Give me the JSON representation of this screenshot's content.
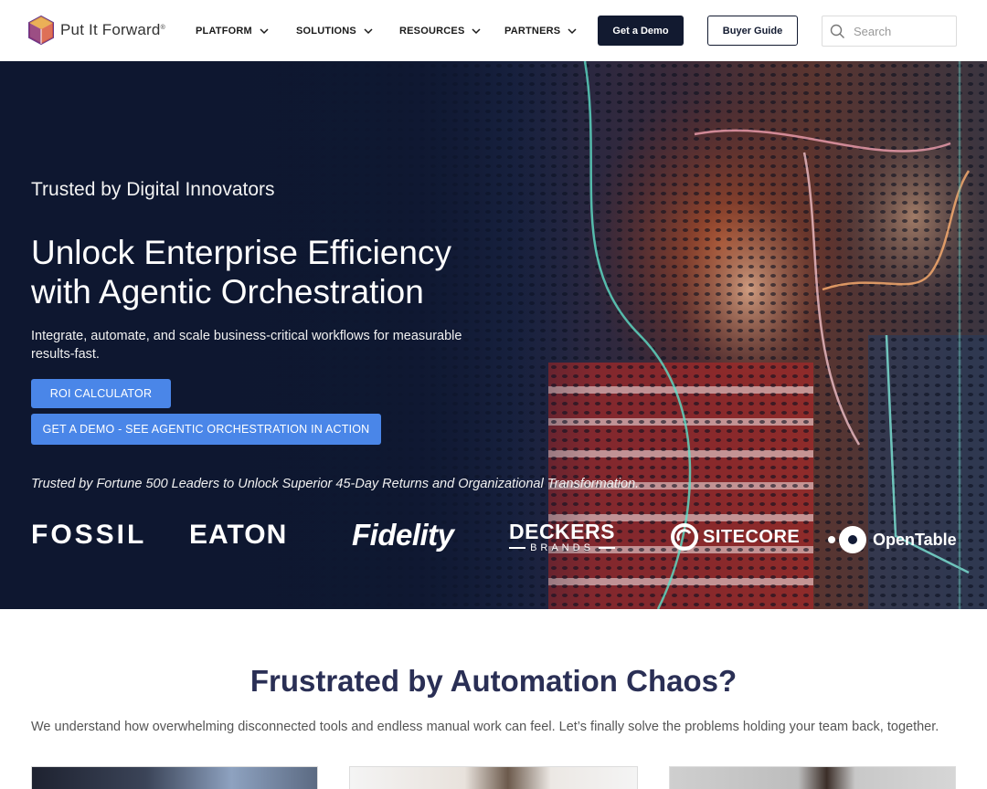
{
  "brand": {
    "name": "Put It Forward",
    "reg": "®"
  },
  "nav": {
    "platform": "PLATFORM",
    "solutions": "SOLUTIONS",
    "resources": "RESOURCES",
    "partners": "PARTNERS"
  },
  "header_buttons": {
    "demo": "Get a Demo",
    "guide": "Buyer Guide"
  },
  "search": {
    "placeholder": "Search"
  },
  "hero": {
    "kicker": "Trusted by Digital Innovators",
    "title_line1": "Unlock Enterprise Efficiency",
    "title_line2": "with Agentic Orchestration",
    "subtitle": "Integrate, automate, and scale business-critical workflows for measurable results-fast.",
    "cta_roi": "ROI CALCULATOR",
    "cta_demo": "GET A DEMO - SEE AGENTIC ORCHESTRATION IN ACTION",
    "trust_line": "Trusted by Fortune 500 Leaders to Unlock Superior 45-Day Returns and Organizational Transformation."
  },
  "clients": {
    "fossil": "FOSSIL",
    "eaton": "EATON",
    "fidelity": "Fidelity",
    "deckers_top": "DECKERS",
    "deckers_bottom": "BRANDS",
    "sitecore": "SITECORE",
    "opentable": "OpenTable"
  },
  "section": {
    "title": "Frustrated by Automation Chaos?",
    "subtitle": "We understand how overwhelming disconnected tools and endless manual work can feel.  Let’s finally solve the problems holding your team back, together."
  },
  "colors": {
    "navy": "#121a30",
    "cta_blue": "#4a86e8",
    "section_title": "#2a2f55"
  }
}
